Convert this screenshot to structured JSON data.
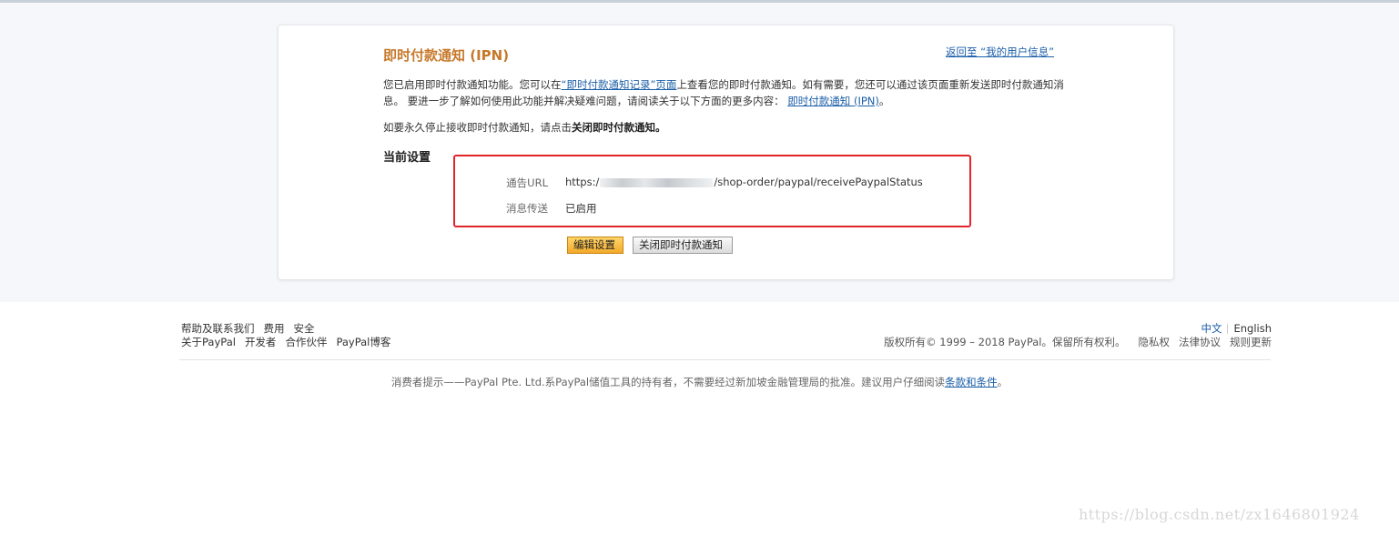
{
  "card": {
    "title": "即时付款通知 (IPN)",
    "back_link": "返回至 “我的用户信息”",
    "para_part1": "您已启用即时付款通知功能。您可以在",
    "para_link1": "“即时付款通知记录”页面",
    "para_part2": "上查看您的即时付款通知。如有需要，您还可以通过该页面重新发送即时付款通知消息。 要进一步了解如何使用此功能并解决疑难问题，请阅读关于以下方面的更多内容：",
    "para_link2": "即时付款通知 (IPN)",
    "para_end": "。",
    "stop_text": "如要永久停止接收即时付款通知，请点击",
    "stop_bold": "关闭即时付款通知。",
    "section_title": "当前设置",
    "settings": {
      "url_label": "通告URL",
      "url_prefix": "https:/",
      "url_suffix": "/shop-order/paypal/receivePaypalStatus",
      "msg_label": "消息传送",
      "msg_value": "已启用"
    },
    "edit_button": "编辑设置",
    "close_button": "关闭即时付款通知"
  },
  "footer": {
    "row1": [
      "帮助及联系我们",
      "费用",
      "安全"
    ],
    "row2": [
      "关于PayPal",
      "开发者",
      "合作伙伴",
      "PayPal博客"
    ],
    "lang_cn": "中文",
    "lang_en": "English",
    "copyright": "版权所有© 1999 – 2018 PayPal。保留所有权利。",
    "legal": [
      "隐私权",
      "法律协议",
      "规则更新"
    ],
    "disclaimer": "消费者提示——PayPal Pte. Ltd.系PayPal储值工具的持有者，不需要经过新加坡金融管理局的批准。建议用户仔细阅读",
    "disclaimer_link": "条款和条件",
    "disclaimer_end": "。"
  },
  "watermark": "https://blog.csdn.net/zx1646801924",
  "colors": {
    "accent": "#c7792b",
    "link": "#1b5ea8",
    "highlight_box": "#e0252b"
  }
}
